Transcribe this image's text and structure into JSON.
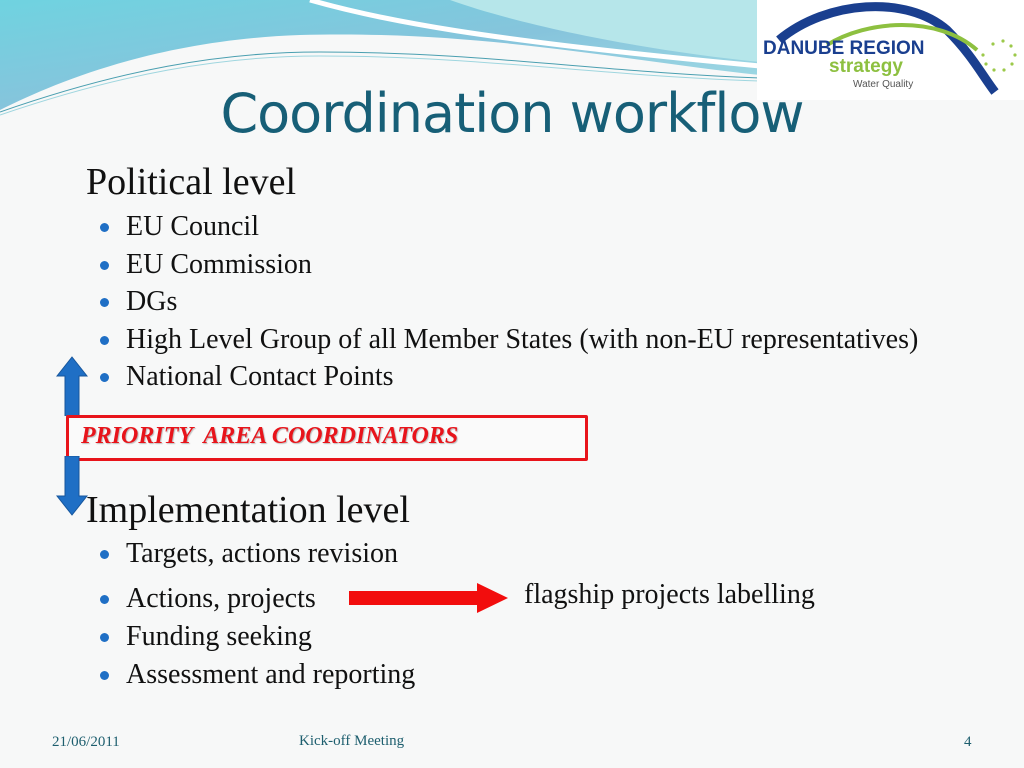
{
  "slide": {
    "title": "Coordination workflow",
    "logo": {
      "line1": "DANUBE REGION",
      "line2": "strategy",
      "line3": "Water Quality"
    },
    "political": {
      "heading": "Political level",
      "items": [
        "EU Council",
        "EU Commission",
        "DGs",
        "High Level Group of all Member States (with non-EU representatives)",
        "National Contact Points"
      ]
    },
    "coordinators_box": "PRIORITY  AREA COORDINATORS",
    "implementation": {
      "heading": "Implementation level",
      "items": [
        "Targets, actions revision",
        "Actions, projects",
        "Funding seeking",
        "Assessment and reporting"
      ],
      "arrow_target": "flagship projects labelling"
    },
    "footer": {
      "date": "21/06/2011",
      "event": "Kick-off Meeting",
      "page_number": "4"
    },
    "colors": {
      "title": "#175f77",
      "bullet": "#1f6fc5",
      "highlight_red": "#e8141b",
      "arrow_blue": "#1f6fc5",
      "logo_blue": "#1a3f8f",
      "logo_green": "#8dc040"
    }
  }
}
